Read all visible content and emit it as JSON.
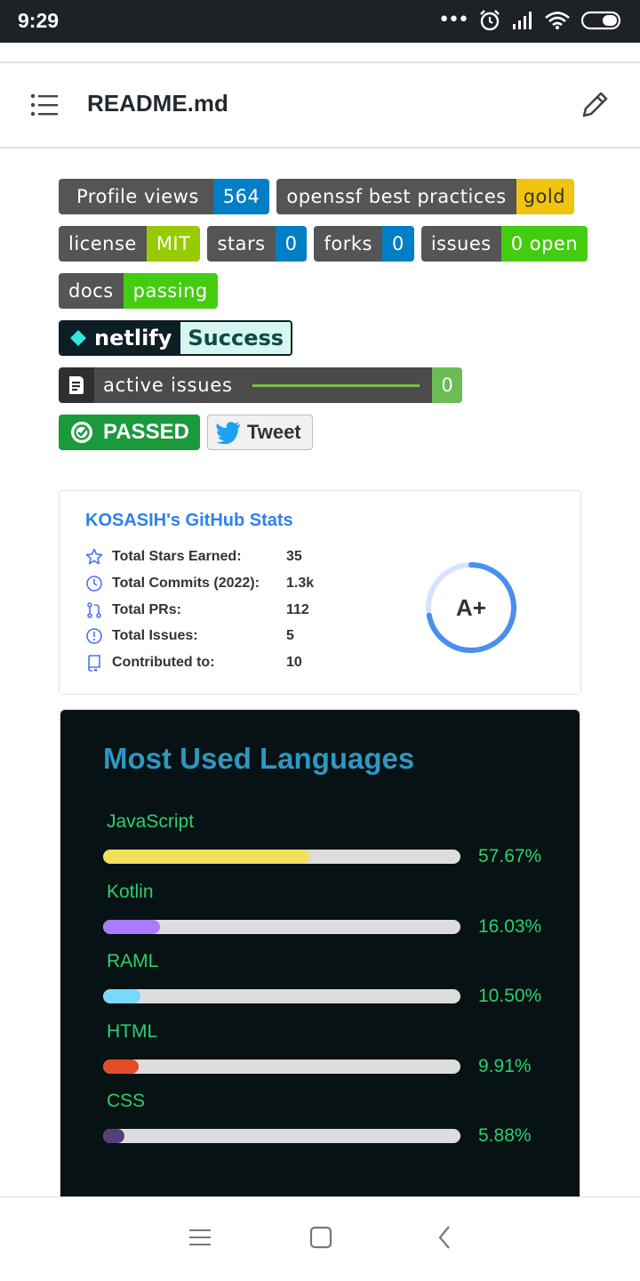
{
  "status_bar": {
    "time": "9:29",
    "dots": "•••"
  },
  "header": {
    "title": "README.md",
    "menu_icon": "list-icon",
    "edit_icon": "pencil-icon"
  },
  "badges": {
    "profile_views": {
      "label": "Profile views",
      "value": "564",
      "color": "#007ec6"
    },
    "openssf": {
      "label": "openssf best practices",
      "value": "gold",
      "color": "#f1c40f"
    },
    "license": {
      "label": "license",
      "value": "MIT",
      "color": "#97ca00"
    },
    "stars": {
      "label": "stars",
      "value": "0",
      "color": "#007ec6"
    },
    "forks": {
      "label": "forks",
      "value": "0",
      "color": "#007ec6"
    },
    "issues": {
      "label": "issues",
      "value": "0 open",
      "color": "#4c1"
    },
    "docs": {
      "label": "docs",
      "value": "passing",
      "color": "#4c1"
    },
    "netlify": {
      "label": "netlify",
      "value": "Success"
    },
    "active_issues": {
      "label": "active issues",
      "value": "0"
    },
    "passed": {
      "label": "PASSED"
    },
    "tweet": {
      "label": "Tweet"
    }
  },
  "github_stats": {
    "title": "KOSASIH's GitHub Stats",
    "rows": [
      {
        "icon": "star-icon",
        "label": "Total Stars Earned:",
        "value": "35"
      },
      {
        "icon": "history-icon",
        "label": "Total Commits (2022):",
        "value": "1.3k"
      },
      {
        "icon": "pull-request-icon",
        "label": "Total PRs:",
        "value": "112"
      },
      {
        "icon": "issue-icon",
        "label": "Total Issues:",
        "value": "5"
      },
      {
        "icon": "repo-icon",
        "label": "Contributed to:",
        "value": "10"
      }
    ],
    "grade": "A+",
    "grade_progress": 0.72,
    "accent": "#2f80ed"
  },
  "languages": {
    "title": "Most Used Languages",
    "items": [
      {
        "name": "JavaScript",
        "percent": "57.67%",
        "fraction": 0.5767,
        "color": "#f1e05a"
      },
      {
        "name": "Kotlin",
        "percent": "16.03%",
        "fraction": 0.1603,
        "color": "#a97bff"
      },
      {
        "name": "RAML",
        "percent": "10.50%",
        "fraction": 0.105,
        "color": "#77d9fb"
      },
      {
        "name": "HTML",
        "percent": "9.91%",
        "fraction": 0.0991,
        "color": "#e34c26"
      },
      {
        "name": "CSS",
        "percent": "5.88%",
        "fraction": 0.0588,
        "color": "#563d7c"
      }
    ]
  },
  "nav_bar": {
    "menu_icon": "menu-icon",
    "home_icon": "home-square-icon",
    "back_icon": "back-chevron-icon"
  }
}
